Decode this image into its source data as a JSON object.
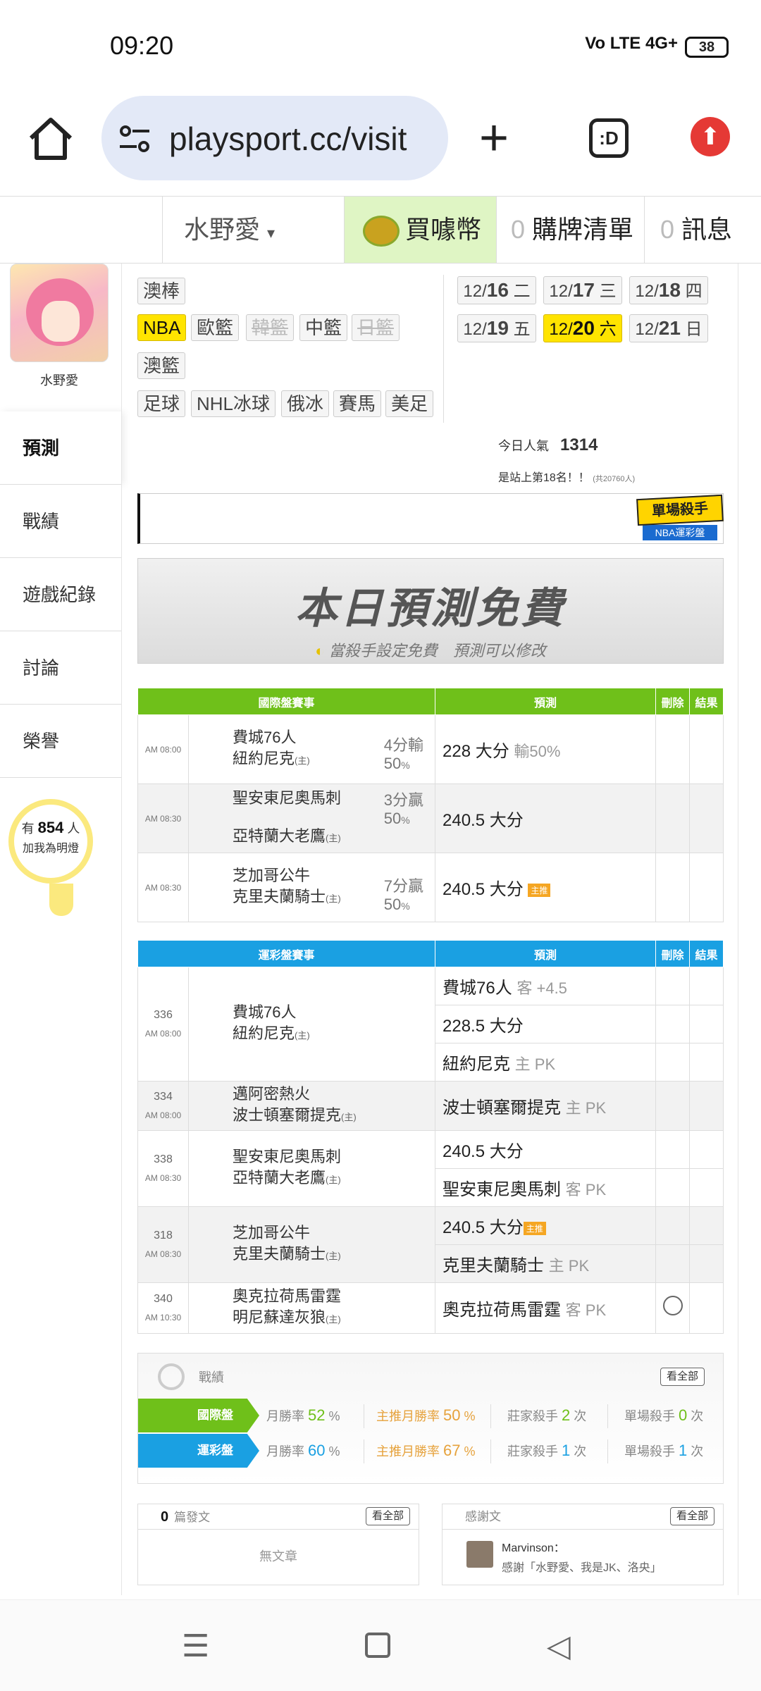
{
  "status": {
    "time": "09:20",
    "network": "Vo LTE 4G+",
    "battery": "38"
  },
  "browser": {
    "url": "playsport.cc/visit",
    "tabs_label": ":D"
  },
  "topnav": {
    "user": "水野愛",
    "coin": "買噱幣",
    "cart_count": "0",
    "cart": "購牌清單",
    "msg_count": "0",
    "msg": "訊息"
  },
  "sidebar": {
    "name": "水野愛",
    "items": [
      {
        "label": "預測"
      },
      {
        "label": "戰績"
      },
      {
        "label": "遊戲紀錄"
      },
      {
        "label": "討論"
      },
      {
        "label": "榮譽"
      }
    ],
    "fans_prefix": "有",
    "fans_count": "854",
    "fans_unit": "人",
    "fans_note": "加我為明燈"
  },
  "sports": {
    "row1": [
      "澳棒"
    ],
    "row2": [
      "NBA",
      "歐籃",
      "韓籃",
      "中籃",
      "日籃"
    ],
    "row3": [
      "澳籃"
    ],
    "row4": [
      "足球",
      "NHL冰球",
      "俄冰",
      "賽馬",
      "美足"
    ]
  },
  "dates": [
    {
      "md": "12/",
      "d": "16",
      "w": "二"
    },
    {
      "md": "12/",
      "d": "17",
      "w": "三"
    },
    {
      "md": "12/",
      "d": "18",
      "w": "四"
    },
    {
      "md": "12/",
      "d": "19",
      "w": "五"
    },
    {
      "md": "12/",
      "d": "20",
      "w": "六"
    },
    {
      "md": "12/",
      "d": "21",
      "w": "日"
    }
  ],
  "popularity": {
    "label": "今日人氣",
    "value": "1314",
    "rank": "是站上第18名！！",
    "total": "(共20760人)"
  },
  "killer_badge": {
    "title": "單場殺手",
    "sub": "NBA運彩盤"
  },
  "free_banner": {
    "title": "本日預測免費",
    "note": "當殺手設定免費　預測可以修改"
  },
  "intl": {
    "headers": [
      "國際盤賽事",
      "預測",
      "刪除",
      "結果"
    ],
    "rows": [
      {
        "time": "AM 08:00",
        "away": "費城76人",
        "home": "紐約尼克",
        "home_tag": "(主)",
        "hcp": "4分輸",
        "hcp2": "50",
        "pred": "228 大分",
        "pred_sub": "輸50%"
      },
      {
        "time": "AM 08:30",
        "away": "聖安東尼奧馬刺",
        "home": "亞特蘭大老鷹",
        "home_tag": "(主)",
        "hcp": "3分贏",
        "hcp2": "50",
        "pred": "240.5 大分",
        "pred_sub": ""
      },
      {
        "time": "AM 08:30",
        "away": "芝加哥公牛",
        "home": "克里夫蘭騎士",
        "home_tag": "(主)",
        "hcp": "7分贏",
        "hcp2": "50",
        "pred": "240.5 大分",
        "pred_sub": "主推"
      }
    ]
  },
  "lottery": {
    "headers": [
      "運彩盤賽事",
      "預測",
      "刪除",
      "結果"
    ],
    "games": [
      {
        "no": "336",
        "time": "AM 08:00",
        "away": "費城76人",
        "home": "紐約尼克",
        "home_tag": "(主)",
        "preds": [
          {
            "pick": "費城76人",
            "sub": "客 +4.5"
          },
          {
            "pick": "228.5 大分",
            "sub": ""
          },
          {
            "pick": "紐約尼克",
            "sub": "主 PK"
          }
        ]
      },
      {
        "no": "334",
        "time": "AM 08:00",
        "away": "邁阿密熱火",
        "home": "波士頓塞爾提克",
        "home_tag": "(主)",
        "preds": [
          {
            "pick": "波士頓塞爾提克",
            "sub": "主 PK"
          }
        ]
      },
      {
        "no": "338",
        "time": "AM 08:30",
        "away": "聖安東尼奧馬刺",
        "home": "亞特蘭大老鷹",
        "home_tag": "(主)",
        "preds": [
          {
            "pick": "240.5 大分",
            "sub": ""
          },
          {
            "pick": "聖安東尼奧馬刺",
            "sub": "客 PK"
          }
        ]
      },
      {
        "no": "318",
        "time": "AM 08:30",
        "away": "芝加哥公牛",
        "home": "克里夫蘭騎士",
        "home_tag": "(主)",
        "preds": [
          {
            "pick": "240.5 大分",
            "sub": "主推"
          },
          {
            "pick": "克里夫蘭騎士",
            "sub": "主 PK"
          }
        ]
      },
      {
        "no": "340",
        "time": "AM 10:30",
        "away": "奧克拉荷馬雷霆",
        "home": "明尼蘇達灰狼",
        "home_tag": "(主)",
        "preds": [
          {
            "pick": "奧克拉荷馬雷霆",
            "sub": "客 PK"
          }
        ]
      }
    ]
  },
  "record": {
    "title": "戰績",
    "see_all": "看全部",
    "intl": {
      "label": "國際盤",
      "month_label": "月勝率",
      "month": "52",
      "main_label": "主推月勝率",
      "main": "50",
      "banker_label": "莊家殺手",
      "banker": "2",
      "single_label": "單場殺手",
      "single": "0",
      "pct": "%",
      "times": "次"
    },
    "lottery": {
      "label": "運彩盤",
      "month_label": "月勝率",
      "month": "60",
      "main_label": "主推月勝率",
      "main": "67",
      "banker_label": "莊家殺手",
      "banker": "1",
      "single_label": "單場殺手",
      "single": "1",
      "pct": "%",
      "times": "次"
    }
  },
  "articles": {
    "count": "0",
    "label": "篇發文",
    "see_all": "看全部",
    "empty": "無文章"
  },
  "thanks": {
    "label": "感謝文",
    "see_all": "看全部",
    "name": "Marvinson：",
    "text": "感謝「水野愛、我是JK、洛央」"
  }
}
